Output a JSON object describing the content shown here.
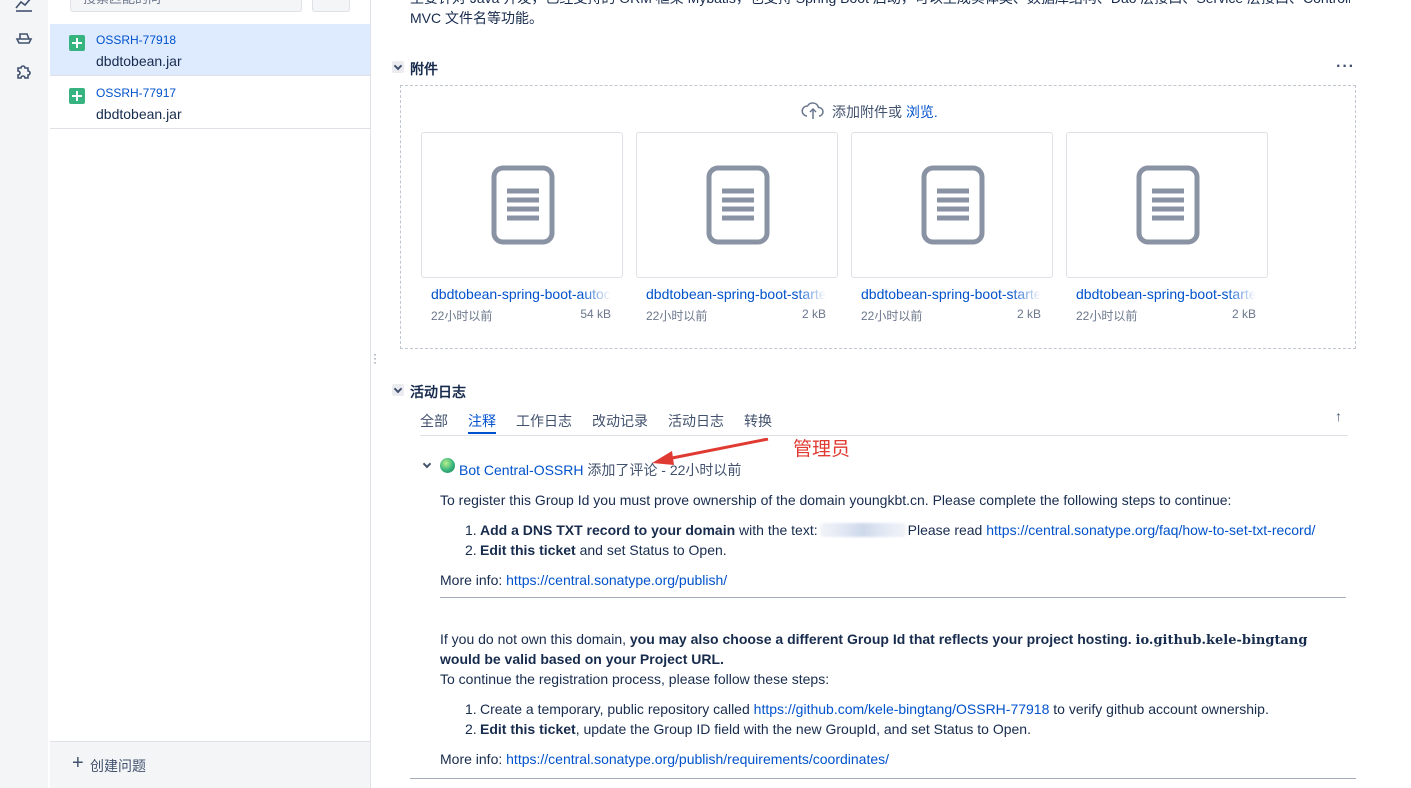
{
  "sidebar": {
    "search_placeholder": "搜索匹配的问",
    "issues": [
      {
        "key": "OSSRH-77918",
        "summary": "dbdtobean.jar",
        "selected": true
      },
      {
        "key": "OSSRH-77917",
        "summary": "dbdtobean.jar",
        "selected": false
      }
    ],
    "create_label": "创建问题"
  },
  "description": {
    "line1": "主要针对 Java 开发，已经支持的 ORM 框架 Mybatis，也支持 Spring Boot 启动，可以生成实体类、数据库结构、Dao 层接口、Service 层接口、Controller 层、MVC 文件名等",
    "line2": "MVC 文件名等功能。"
  },
  "attachments": {
    "title": "附件",
    "more": "···",
    "drop_text": "添加附件或",
    "browse": "浏览.",
    "files": [
      {
        "name": "dbdtobean-spring-boot-autoconfigure.jar",
        "time": "22小时以前",
        "size": "54 kB"
      },
      {
        "name": "dbdtobean-spring-boot-starter.pom",
        "time": "22小时以前",
        "size": "2 kB"
      },
      {
        "name": "dbdtobean-spring-boot-starter.jar",
        "time": "22小时以前",
        "size": "2 kB"
      },
      {
        "name": "dbdtobean-spring-boot-starter-sources.jar",
        "time": "22小时以前",
        "size": "2 kB"
      }
    ]
  },
  "activity": {
    "title": "活动日志",
    "sort_icon": "↑",
    "tabs": [
      {
        "label": "全部",
        "active": false
      },
      {
        "label": "注释",
        "active": true
      },
      {
        "label": "工作日志",
        "active": false
      },
      {
        "label": "改动记录",
        "active": false
      },
      {
        "label": "活动日志",
        "active": false
      },
      {
        "label": "转换",
        "active": false
      }
    ]
  },
  "annotation": {
    "text": "管理员",
    "color": "#e03b32"
  },
  "comment": {
    "author": "Bot Central-OSSRH",
    "action": "添加了评论",
    "separator": " - ",
    "time": "22小时以前",
    "p1": "To register this Group Id you must prove ownership of the domain youngkbt.cn. Please complete the following steps to continue:",
    "list1": [
      {
        "num": "1.",
        "bold": "Add a DNS TXT record to your domain",
        "rest": " with the text:",
        "after": "Please read ",
        "link": "https://central.sonatype.org/faq/how-to-set-txt-record/"
      },
      {
        "num": "2.",
        "bold": "Edit this ticket",
        "rest": " and set Status to Open."
      }
    ],
    "more1_label": "More info: ",
    "more1_link": "https://central.sonatype.org/publish/",
    "p2_a": "If you do not own this domain, ",
    "p2_b": "you may also choose a different Group Id that reflects your project hosting. ",
    "p2_code": "io.github.kele-bingtang",
    "p2_c": "would be valid based on your Project URL.",
    "p3": "To continue the registration process, please follow these steps:",
    "list2": [
      {
        "num": "1.",
        "pre": "Create a temporary, public repository called ",
        "link": "https://github.com/kele-bingtang/OSSRH-77918",
        "post": " to verify github account ownership."
      },
      {
        "num": "2.",
        "bold": "Edit this ticket",
        "rest": ", update the Group ID field with the new GroupId, and set Status to Open."
      }
    ],
    "more2_label": "More info: ",
    "more2_link": "https://central.sonatype.org/publish/requirements/coordinates/"
  }
}
